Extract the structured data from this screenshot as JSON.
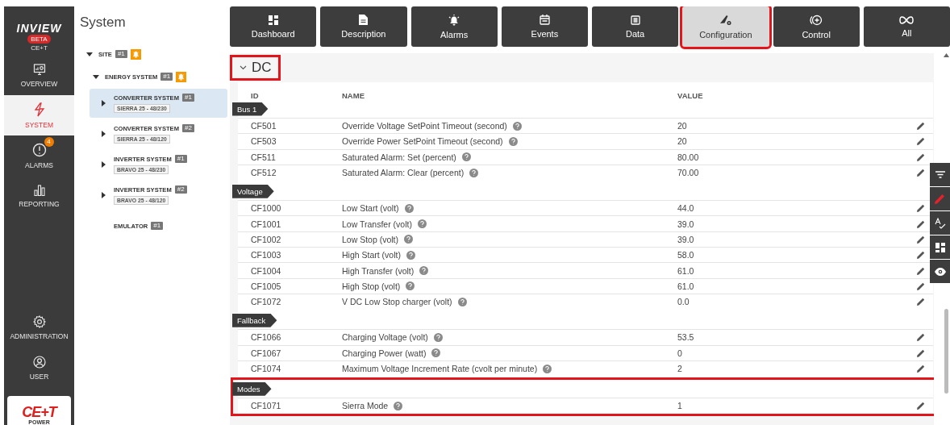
{
  "brand": {
    "logo": "INVIEW",
    "badge": "BETA",
    "company": "CE+T"
  },
  "nav": [
    {
      "kind": "overview",
      "label": "OVERVIEW",
      "selected": false
    },
    {
      "kind": "system",
      "label": "SYSTEM",
      "selected": true
    },
    {
      "kind": "alarms",
      "label": "ALARMS",
      "selected": false,
      "badge": "4"
    },
    {
      "kind": "reporting",
      "label": "REPORTING",
      "selected": false
    },
    {
      "kind": "administration",
      "label": "ADMINISTRATION",
      "selected": false
    },
    {
      "kind": "user",
      "label": "USER",
      "selected": false
    }
  ],
  "footer_logo": {
    "mark": "CE+T",
    "tagline": "POWER"
  },
  "tree": {
    "title": "System",
    "nodes": [
      {
        "label": "SITE",
        "count": "#1",
        "alarm": true,
        "expanded": true,
        "selected": false,
        "children": [
          {
            "label": "ENERGY SYSTEM",
            "count": "#1",
            "alarm": true,
            "expanded": true,
            "selected": false,
            "children": [
              {
                "label": "CONVERTER SYSTEM",
                "count": "#1",
                "model": "SIERRA 25 - 48/230",
                "alarm": false,
                "expanded": false,
                "selected": true
              },
              {
                "label": "CONVERTER SYSTEM",
                "count": "#2",
                "model": "SIERRA 25 - 48/120",
                "alarm": false,
                "expanded": false,
                "selected": false
              },
              {
                "label": "INVERTER SYSTEM",
                "count": "#1",
                "model": "BRAVO 25 - 48/230",
                "alarm": false,
                "expanded": false,
                "selected": false
              },
              {
                "label": "INVERTER SYSTEM",
                "count": "#2",
                "model": "BRAVO 25 - 48/120",
                "alarm": false,
                "expanded": false,
                "selected": false
              },
              {
                "label": "EMULATOR",
                "count": "#1",
                "alarm": false,
                "selected": false
              }
            ]
          }
        ]
      }
    ]
  },
  "tabs": [
    {
      "kind": "dashboard",
      "label": "Dashboard",
      "selected": false,
      "highlighted": false
    },
    {
      "kind": "description",
      "label": "Description",
      "selected": false,
      "highlighted": false
    },
    {
      "kind": "alarms",
      "label": "Alarms",
      "selected": false,
      "highlighted": false
    },
    {
      "kind": "events",
      "label": "Events",
      "selected": false,
      "highlighted": false
    },
    {
      "kind": "data",
      "label": "Data",
      "selected": false,
      "highlighted": false
    },
    {
      "kind": "configuration",
      "label": "Configuration",
      "selected": true,
      "highlighted": true
    },
    {
      "kind": "control",
      "label": "Control",
      "selected": false,
      "highlighted": false
    },
    {
      "kind": "all",
      "label": "All",
      "selected": false,
      "highlighted": false
    }
  ],
  "section": {
    "title": "DC",
    "expanded": true,
    "highlighted": true,
    "columns": [
      "ID",
      "NAME",
      "VALUE"
    ],
    "groups": [
      {
        "label": "Bus 1",
        "highlighted": false,
        "rows": [
          {
            "id": "CF501",
            "name": "Override Voltage SetPoint Timeout (second)",
            "value": "20",
            "editable": true
          },
          {
            "id": "CF503",
            "name": "Override Power SetPoint Timeout (second)",
            "value": "20",
            "editable": true
          },
          {
            "id": "CF511",
            "name": "Saturated Alarm: Set (percent)",
            "value": "80.00",
            "editable": true
          },
          {
            "id": "CF512",
            "name": "Saturated Alarm: Clear (percent)",
            "value": "70.00",
            "editable": true
          }
        ]
      },
      {
        "label": "Voltage",
        "highlighted": false,
        "rows": [
          {
            "id": "CF1000",
            "name": "Low Start (volt)",
            "value": "44.0",
            "editable": true
          },
          {
            "id": "CF1001",
            "name": "Low Transfer (volt)",
            "value": "39.0",
            "editable": true
          },
          {
            "id": "CF1002",
            "name": "Low Stop (volt)",
            "value": "39.0",
            "editable": true
          },
          {
            "id": "CF1003",
            "name": "High Start (volt)",
            "value": "58.0",
            "editable": true
          },
          {
            "id": "CF1004",
            "name": "High Transfer (volt)",
            "value": "61.0",
            "editable": true
          },
          {
            "id": "CF1005",
            "name": "High Stop (volt)",
            "value": "61.0",
            "editable": true
          },
          {
            "id": "CF1072",
            "name": "V DC Low Stop charger (volt)",
            "value": "0.0",
            "editable": true
          }
        ]
      },
      {
        "label": "Fallback",
        "highlighted": false,
        "rows": [
          {
            "id": "CF1066",
            "name": "Charging Voltage (volt)",
            "value": "53.5",
            "editable": true
          },
          {
            "id": "CF1067",
            "name": "Charging Power (watt)",
            "value": "0",
            "editable": true
          },
          {
            "id": "CF1074",
            "name": "Maximum Voltage Increment Rate (cvolt per minute)",
            "value": "2",
            "editable": true
          }
        ]
      },
      {
        "label": "Modes",
        "highlighted": true,
        "rows": [
          {
            "id": "CF1071",
            "name": "Sierra Mode",
            "value": "1",
            "editable": true
          }
        ]
      }
    ]
  },
  "side_tools": [
    {
      "kind": "filter",
      "selected": false
    },
    {
      "kind": "edit",
      "selected": true
    },
    {
      "kind": "spellcheck",
      "selected": false
    },
    {
      "kind": "layout",
      "selected": false
    },
    {
      "kind": "view",
      "selected": false
    }
  ]
}
